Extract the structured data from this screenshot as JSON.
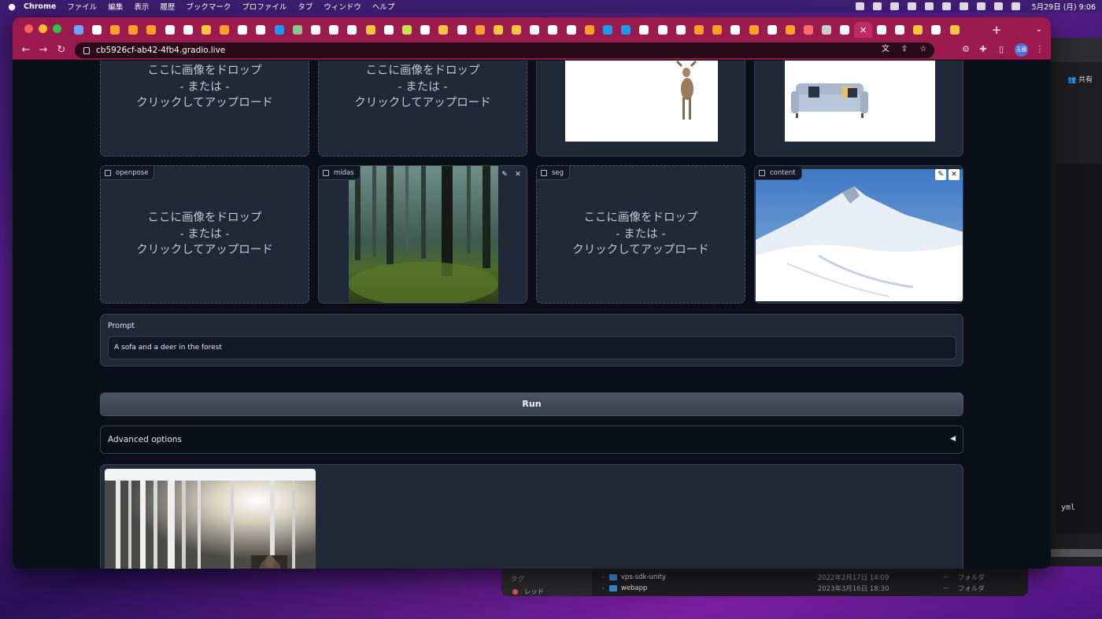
{
  "menubar": {
    "app": "Chrome",
    "items": [
      "ファイル",
      "編集",
      "表示",
      "履歴",
      "ブックマーク",
      "プロファイル",
      "タブ",
      "ウィンドウ",
      "ヘルプ"
    ],
    "clock": "5月29日 (月)  9:06"
  },
  "browser": {
    "url": "cb5926cf-ab42-4fb4.gradio.live",
    "profile_initials": "玉藤",
    "tab_count": 49,
    "accent_color": "#9c1b4f"
  },
  "upload": {
    "line1": "ここに画像をドロップ",
    "line2": "- または -",
    "line3": "クリックしてアップロード"
  },
  "image_inputs": [
    {
      "label": "openpose"
    },
    {
      "label": "midas"
    },
    {
      "label": "seg"
    },
    {
      "label": "content"
    }
  ],
  "prompt": {
    "label": "Prompt",
    "value": "A sofa and a deer in the forest"
  },
  "run_button": "Run",
  "advanced": {
    "label": "Advanced options",
    "arrow": "◀"
  },
  "background_window": {
    "share_label": "共有",
    "yml_text": "yml"
  },
  "finder": {
    "sidebar_title": "タグ",
    "sidebar_tag": "レッド",
    "rows": [
      {
        "name": "vps-sdk-unity",
        "date": "2022年2月17日 14:09",
        "size": "--",
        "kind": "フォルダ"
      },
      {
        "name": "webapp",
        "date": "2023年3月16日 18:30",
        "size": "--",
        "kind": "フォルダ"
      }
    ]
  }
}
